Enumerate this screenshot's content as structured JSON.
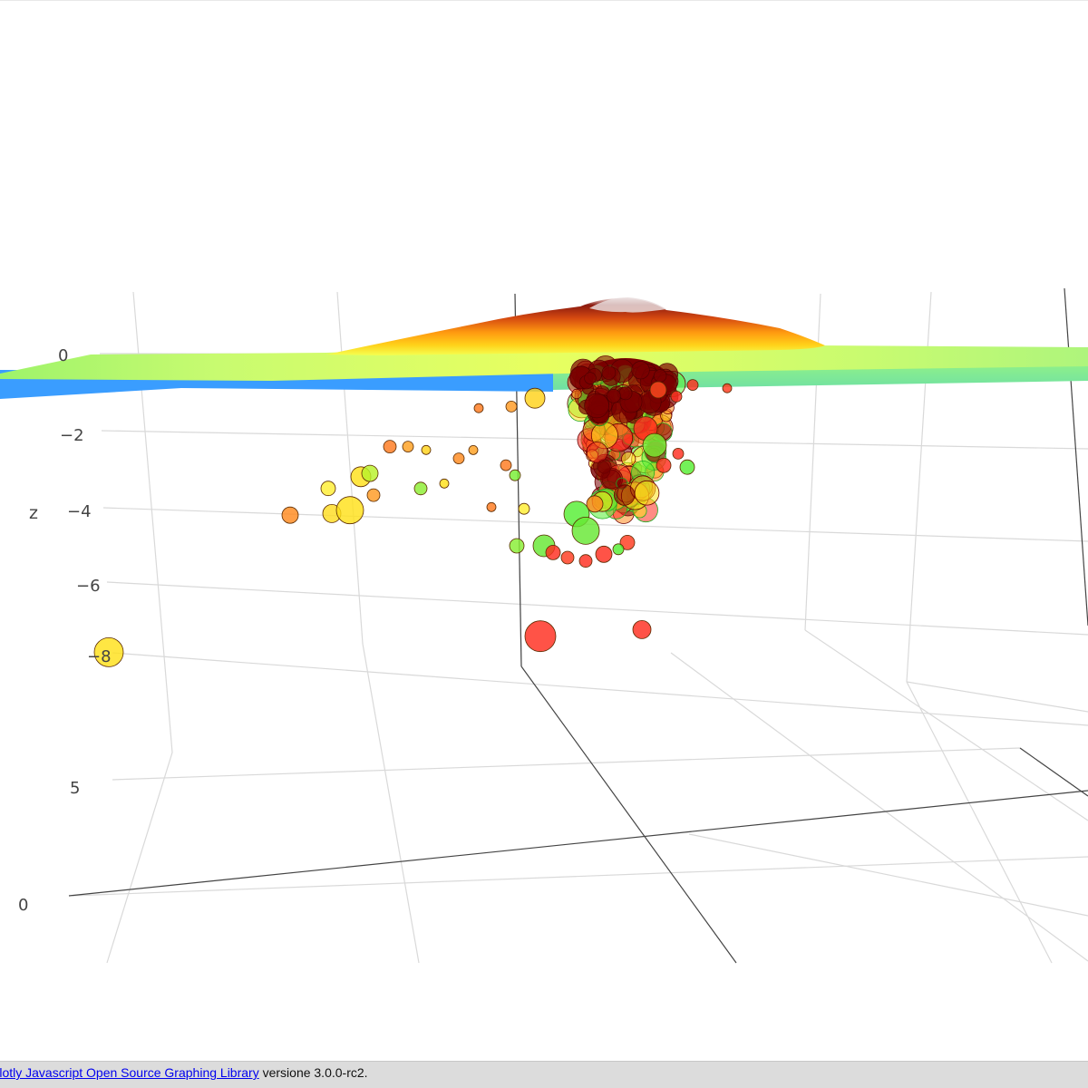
{
  "footer": {
    "link_text": "Plotly Javascript Open Source Graphing Library",
    "suffix_text": " versione 3.0.0-rc2."
  },
  "colors": {
    "bubble_dense": "#7a0000",
    "bubble_red": "#ff2d1f",
    "bubble_orange": "#ff8a1e",
    "bubble_yellow": "#ffe11a",
    "bubble_green": "#55ee33",
    "surface_low": "#3ea0ff",
    "surface_high": "#8b1a0f",
    "grid": "#d9d9d9",
    "axis": "#444444"
  },
  "chart_data": {
    "type": "scatter3d",
    "traces": [
      "surface",
      "scatter3d"
    ],
    "surface_colorscale": "jet",
    "marker_colorscale": "green-yellow-red",
    "z_axis": {
      "label": "z",
      "ticks": [
        "0",
        "−2",
        "−4",
        "−6",
        "−8"
      ],
      "range": [
        -9,
        1
      ]
    },
    "y_axis": {
      "ticks": [
        "5",
        "0"
      ]
    },
    "points": [
      {
        "x": 0.55,
        "y": 2.0,
        "z": -0.6,
        "size": 22,
        "color": "#ffd21a"
      },
      {
        "x": 0.53,
        "y": 2.1,
        "z": -0.8,
        "size": 12,
        "color": "#ff9a22"
      },
      {
        "x": 0.5,
        "y": 2.2,
        "z": -0.8,
        "size": 10,
        "color": "#ff7a1e"
      },
      {
        "x": 0.68,
        "y": 1.9,
        "z": -0.4,
        "size": 18,
        "color": "#ff4a1e"
      },
      {
        "x": 0.7,
        "y": 1.9,
        "z": -0.6,
        "size": 12,
        "color": "#ff2d1f"
      },
      {
        "x": 0.75,
        "y": 1.8,
        "z": -0.4,
        "size": 10,
        "color": "#ff3a1e"
      },
      {
        "x": 0.42,
        "y": 2.5,
        "z": -1.8,
        "size": 14,
        "color": "#ff7a1e"
      },
      {
        "x": 0.44,
        "y": 2.5,
        "z": -1.8,
        "size": 12,
        "color": "#ffa020"
      },
      {
        "x": 0.46,
        "y": 2.5,
        "z": -1.9,
        "size": 10,
        "color": "#ffd21a"
      },
      {
        "x": 0.4,
        "y": 2.7,
        "z": -2.6,
        "size": 22,
        "color": "#ffe11a"
      },
      {
        "x": 0.41,
        "y": 2.7,
        "z": -2.5,
        "size": 18,
        "color": "#b8f22a"
      },
      {
        "x": 0.37,
        "y": 2.8,
        "z": -2.9,
        "size": 16,
        "color": "#ffee33"
      },
      {
        "x": 0.34,
        "y": 3.0,
        "z": -3.6,
        "size": 18,
        "color": "#ff8a1e"
      },
      {
        "x": 0.38,
        "y": 2.9,
        "z": -3.6,
        "size": 20,
        "color": "#ffdd22"
      },
      {
        "x": 0.4,
        "y": 2.9,
        "z": -3.5,
        "size": 30,
        "color": "#ffe11a"
      },
      {
        "x": 0.42,
        "y": 2.8,
        "z": -3.1,
        "size": 14,
        "color": "#ff9a22"
      },
      {
        "x": 0.46,
        "y": 2.6,
        "z": -3.0,
        "size": 14,
        "color": "#8cee33"
      },
      {
        "x": 0.48,
        "y": 2.5,
        "z": -2.9,
        "size": 10,
        "color": "#ffe11a"
      },
      {
        "x": 0.49,
        "y": 2.4,
        "z": -2.2,
        "size": 12,
        "color": "#ff8a1e"
      },
      {
        "x": 0.5,
        "y": 2.3,
        "z": -2.0,
        "size": 10,
        "color": "#ffa020"
      },
      {
        "x": 0.53,
        "y": 2.2,
        "z": -2.5,
        "size": 12,
        "color": "#ff7a1e"
      },
      {
        "x": 0.54,
        "y": 2.2,
        "z": -2.8,
        "size": 12,
        "color": "#77ee33"
      },
      {
        "x": 0.52,
        "y": 2.3,
        "z": -3.7,
        "size": 10,
        "color": "#ff7a1e"
      },
      {
        "x": 0.55,
        "y": 2.2,
        "z": -3.8,
        "size": 12,
        "color": "#ffee33"
      },
      {
        "x": 0.53,
        "y": 2.0,
        "z": -5.0,
        "size": 16,
        "color": "#88ee33"
      },
      {
        "x": 0.56,
        "y": 2.0,
        "z": -5.0,
        "size": 24,
        "color": "#66e833"
      },
      {
        "x": 0.57,
        "y": 2.0,
        "z": -5.2,
        "size": 16,
        "color": "#ff2d1f"
      },
      {
        "x": 0.58,
        "y": 1.9,
        "z": -5.4,
        "size": 14,
        "color": "#ff3a1e"
      },
      {
        "x": 0.6,
        "y": 1.9,
        "z": -5.5,
        "size": 14,
        "color": "#ff2d1f"
      },
      {
        "x": 0.62,
        "y": 1.9,
        "z": -5.3,
        "size": 18,
        "color": "#ff2d1f"
      },
      {
        "x": 0.64,
        "y": 1.8,
        "z": -5.0,
        "size": 16,
        "color": "#ff3a1e"
      },
      {
        "x": 0.63,
        "y": 1.8,
        "z": -5.2,
        "size": 12,
        "color": "#55ee33"
      },
      {
        "x": 0.59,
        "y": 1.9,
        "z": -4.1,
        "size": 28,
        "color": "#55ee33"
      },
      {
        "x": 0.6,
        "y": 1.9,
        "z": -4.6,
        "size": 30,
        "color": "#66e833"
      },
      {
        "x": 0.61,
        "y": 1.9,
        "z": -3.8,
        "size": 18,
        "color": "#ff8a1e"
      },
      {
        "x": 0.66,
        "y": 1.8,
        "z": -1.6,
        "size": 26,
        "color": "#ff2d1f"
      },
      {
        "x": 0.67,
        "y": 1.8,
        "z": -2.1,
        "size": 26,
        "color": "#77ee33"
      },
      {
        "x": 0.68,
        "y": 1.8,
        "z": -2.7,
        "size": 16,
        "color": "#ff2d1f"
      },
      {
        "x": 0.7,
        "y": 1.7,
        "z": -2.8,
        "size": 16,
        "color": "#55ee33"
      },
      {
        "x": 0.69,
        "y": 1.7,
        "z": -2.4,
        "size": 12,
        "color": "#ff2d1f"
      },
      {
        "x": 0.7,
        "y": 1.6,
        "z": -0.4,
        "size": 12,
        "color": "#ff2d1f"
      },
      {
        "x": 0.58,
        "y": 2.4,
        "z": -7.5,
        "size": 34,
        "color": "#ff2d1f"
      },
      {
        "x": 0.68,
        "y": 2.2,
        "z": -7.4,
        "size": 20,
        "color": "#ff2d1f"
      },
      {
        "x": 0.2,
        "y": 4.0,
        "z": -7.2,
        "size": 32,
        "color": "#ffe11a"
      }
    ]
  }
}
